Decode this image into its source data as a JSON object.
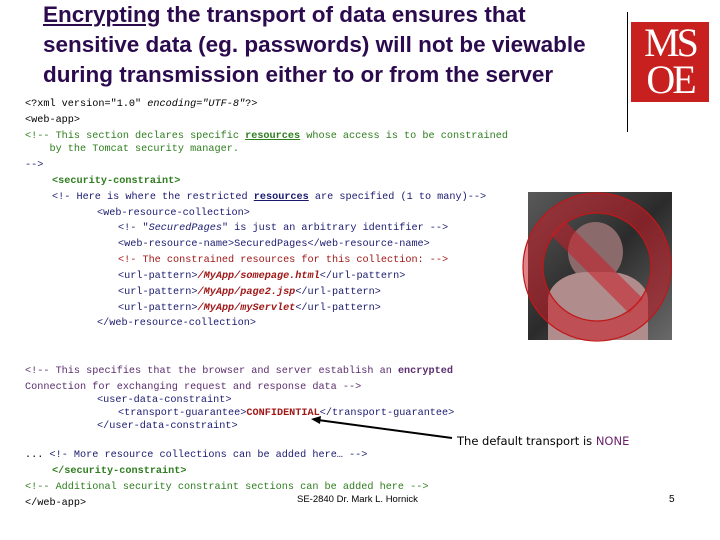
{
  "title": {
    "underlined_word": "Encrypting",
    "line1_rest": " the transport of data ensures that",
    "line2": "sensitive data (eg. passwords) will not be viewable",
    "line3": "during transmission either to or from the server"
  },
  "logo": {
    "line1": "MS",
    "line2": "OE"
  },
  "code": {
    "l1a": "<?xml version=\"1.0\" ",
    "l1b": "encoding=\"UTF-8\"",
    "l1c": "?>",
    "l2": "<web-app>",
    "l3a": "<!-- This section declares specific ",
    "l3b": "resources",
    "l3c": " whose access is to be constrained",
    "l4": "    by the Tomcat security manager.",
    "l5": "-->",
    "l6": "<security-constraint>",
    "l7a": "<!- Here is where the restricted ",
    "l7b": "resources",
    "l7c": " are specified (1 to many)-->",
    "l8": "<web-resource-collection>",
    "l9a": "<!- \"",
    "l9b": "SecuredPages",
    "l9c": "\" is just an arbitrary identifier -->",
    "l10": "<web-resource-name>SecuredPages</web-resource-name>",
    "l11": "<!- The constrained resources for this collection: -->",
    "url_open": "<url-pattern>",
    "url_close": "</url-pattern>",
    "urls": [
      "/MyApp/somepage.html",
      "/MyApp/page2.jsp",
      "/MyApp/myServlet"
    ],
    "l15": "</web-resource-collection>",
    "l16a": "<!-- This specifies that the browser and server establish an ",
    "l16b": "encrypted",
    "l17": "Connection for exchanging request and response data -->",
    "l18": "<user-data-constraint>",
    "l19a": "<transport-guarantee>",
    "l19b": "CONFIDENTIAL",
    "l19c": "</transport-guarantee>",
    "l20": "</user-data-constraint>",
    "l21a": "... ",
    "l21b": "<!- More resource collections can be added here… -->",
    "l22": "</security-constraint>",
    "l23": "<!-- Additional security constraint sections can be added here -->",
    "l24": "</web-app>"
  },
  "note": {
    "text": "The default transport is ",
    "value": "NONE"
  },
  "footer": "SE-2840 Dr. Mark L. Hornick",
  "page_number": "5"
}
